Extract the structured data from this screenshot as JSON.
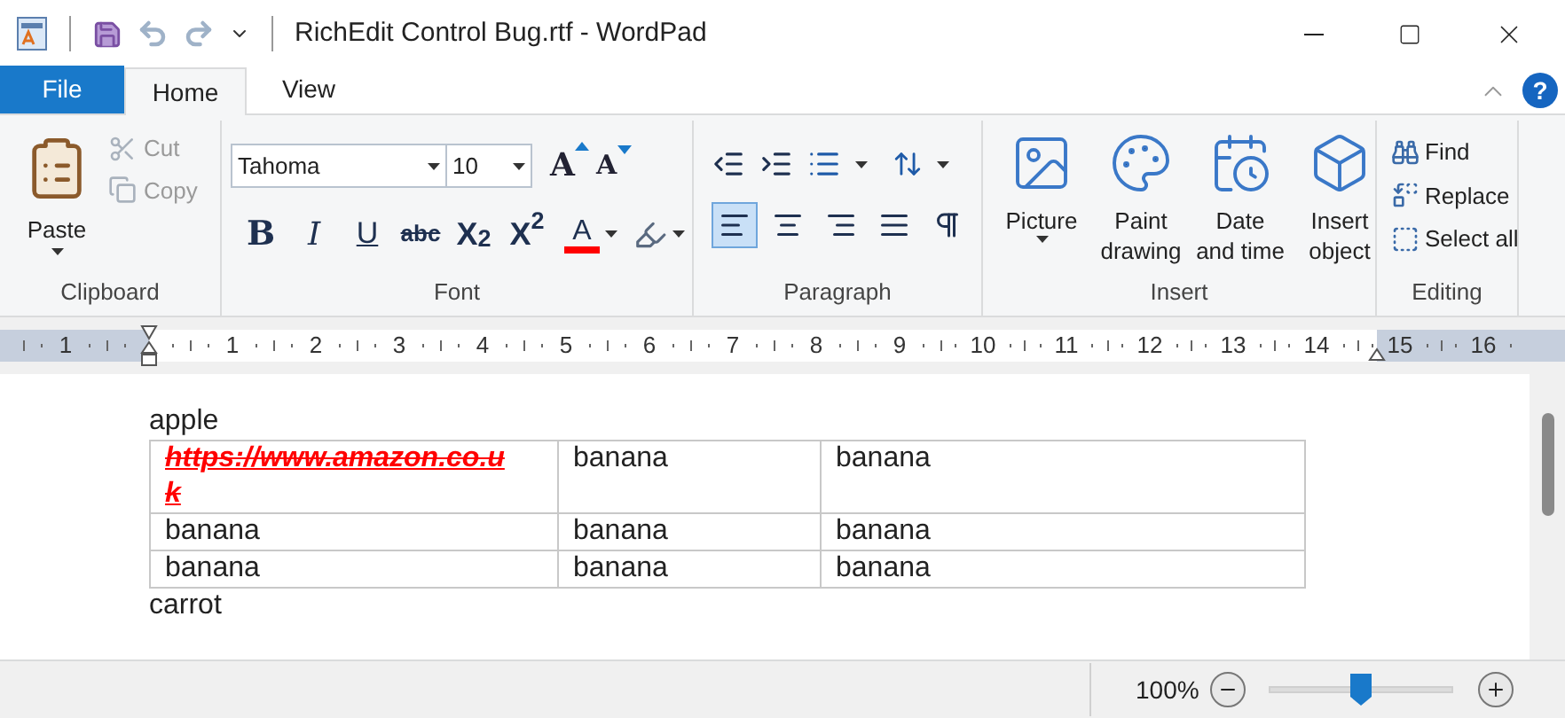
{
  "window": {
    "title": "RichEdit Control Bug.rtf - WordPad"
  },
  "tabs": [
    {
      "label": "File",
      "kind": "file"
    },
    {
      "label": "Home",
      "kind": "tab",
      "selected": true
    },
    {
      "label": "View",
      "kind": "tab",
      "selected": false
    }
  ],
  "help": "?",
  "clipboard": {
    "label": "Clipboard",
    "paste": "Paste",
    "buttons": [
      {
        "label": "Cut",
        "kind": "cut",
        "disabled": true
      },
      {
        "label": "Copy",
        "kind": "copy",
        "disabled": true
      }
    ]
  },
  "font": {
    "label": "Font",
    "font_name": "Tahoma",
    "font_size": "10",
    "grow": "A",
    "shrink": "A",
    "styles": [
      {
        "text": "B",
        "kind": "bold"
      },
      {
        "text": "I",
        "kind": "italic"
      },
      {
        "text": "U",
        "kind": "underline"
      },
      {
        "text": "abc",
        "kind": "strike"
      },
      {
        "text": "X$_{2}$",
        "kind": "sub"
      },
      {
        "text": "X$^{2}$",
        "kind": "sup"
      }
    ],
    "color_letter": "A"
  },
  "paragraph": {
    "label": "Paragraph",
    "align": [
      {
        "kind": "left",
        "selected": true
      },
      {
        "kind": "center",
        "selected": false
      },
      {
        "kind": "right",
        "selected": false
      },
      {
        "kind": "justify",
        "selected": false
      },
      {
        "kind": "rtl",
        "selected": false
      }
    ]
  },
  "insert": {
    "label": "Insert",
    "buttons": [
      {
        "kind": "picture",
        "label": "Picture"
      },
      {
        "kind": "paint",
        "label": "Paint drawing"
      },
      {
        "kind": "datetime",
        "label": "Date and time"
      },
      {
        "kind": "object",
        "label": "Insert object"
      }
    ]
  },
  "editing": {
    "label": "Editing",
    "buttons": [
      {
        "kind": "find",
        "label": "Find"
      },
      {
        "kind": "replace",
        "label": "Replace"
      },
      {
        "kind": "select",
        "label": "Select all"
      }
    ]
  },
  "ruler": {
    "left_labels": [
      "1"
    ],
    "labels": [
      "1",
      "2",
      "3",
      "4",
      "5",
      "6",
      "7",
      "8",
      "9",
      "10",
      "11",
      "12",
      "13",
      "14",
      "15",
      "16"
    ]
  },
  "document": {
    "before": "apple",
    "table": {
      "rows": [
        [
          "https://www.amazon.co.uk",
          "banana",
          "banana"
        ],
        [
          "banana",
          "banana",
          "banana"
        ],
        [
          "banana",
          "banana",
          "banana"
        ]
      ]
    },
    "after": "carrot"
  },
  "status_bar": {
    "zoom": "100%",
    "level": 0.5
  }
}
